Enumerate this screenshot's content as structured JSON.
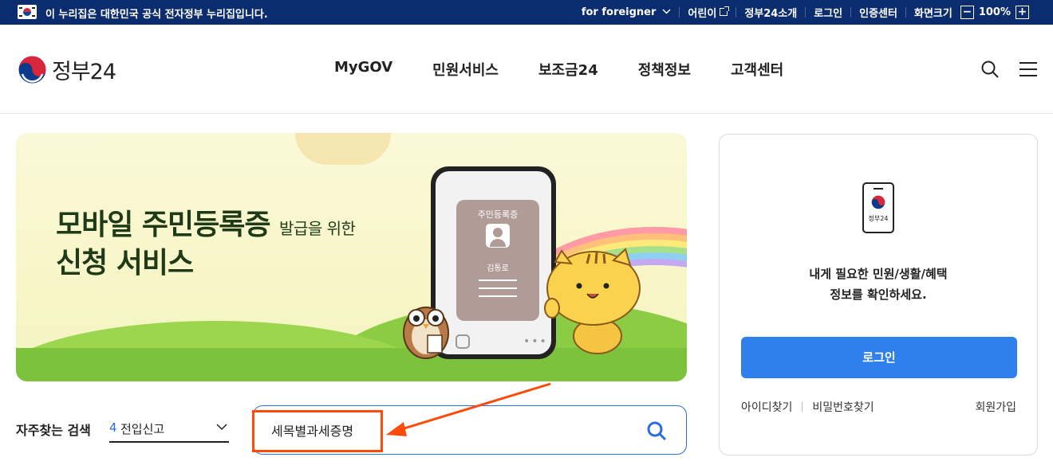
{
  "gov_bar": {
    "notice": "이 누리집은 대한민국 공식 전자정부 누리집입니다.",
    "links": [
      "for foreigner",
      "어린이",
      "정부24소개",
      "로그인",
      "인증센터",
      "화면크기"
    ],
    "zoom": "100%",
    "zoom_minus": "−",
    "zoom_plus": "+"
  },
  "header": {
    "logo_text": "정부24",
    "nav": [
      "MyGOV",
      "민원서비스",
      "보조금24",
      "정책정보",
      "고객센터"
    ]
  },
  "banner": {
    "title_line1_bold": "모바일 주민등록증",
    "title_line1_small": "발급을 위한",
    "title_line2": "신청 서비스",
    "card_label": "주민등록증",
    "card_name": "김통로"
  },
  "search": {
    "label": "자주찾는 검색",
    "freq_number": "4",
    "freq_text": "전입신고",
    "value": "세목별과세증명"
  },
  "login_panel": {
    "device_text": "정부24",
    "message_line1": "내게 필요한 민원/생활/혜택",
    "message_line2": "정보를 확인하세요.",
    "login_button": "로그인",
    "find_id": "아이디찾기",
    "find_pw": "비밀번호찾기",
    "join": "회원가입"
  },
  "colors": {
    "gov_bar": "#0b2c6e",
    "accent": "#2f80ed",
    "highlight": "#ff4b0a"
  }
}
